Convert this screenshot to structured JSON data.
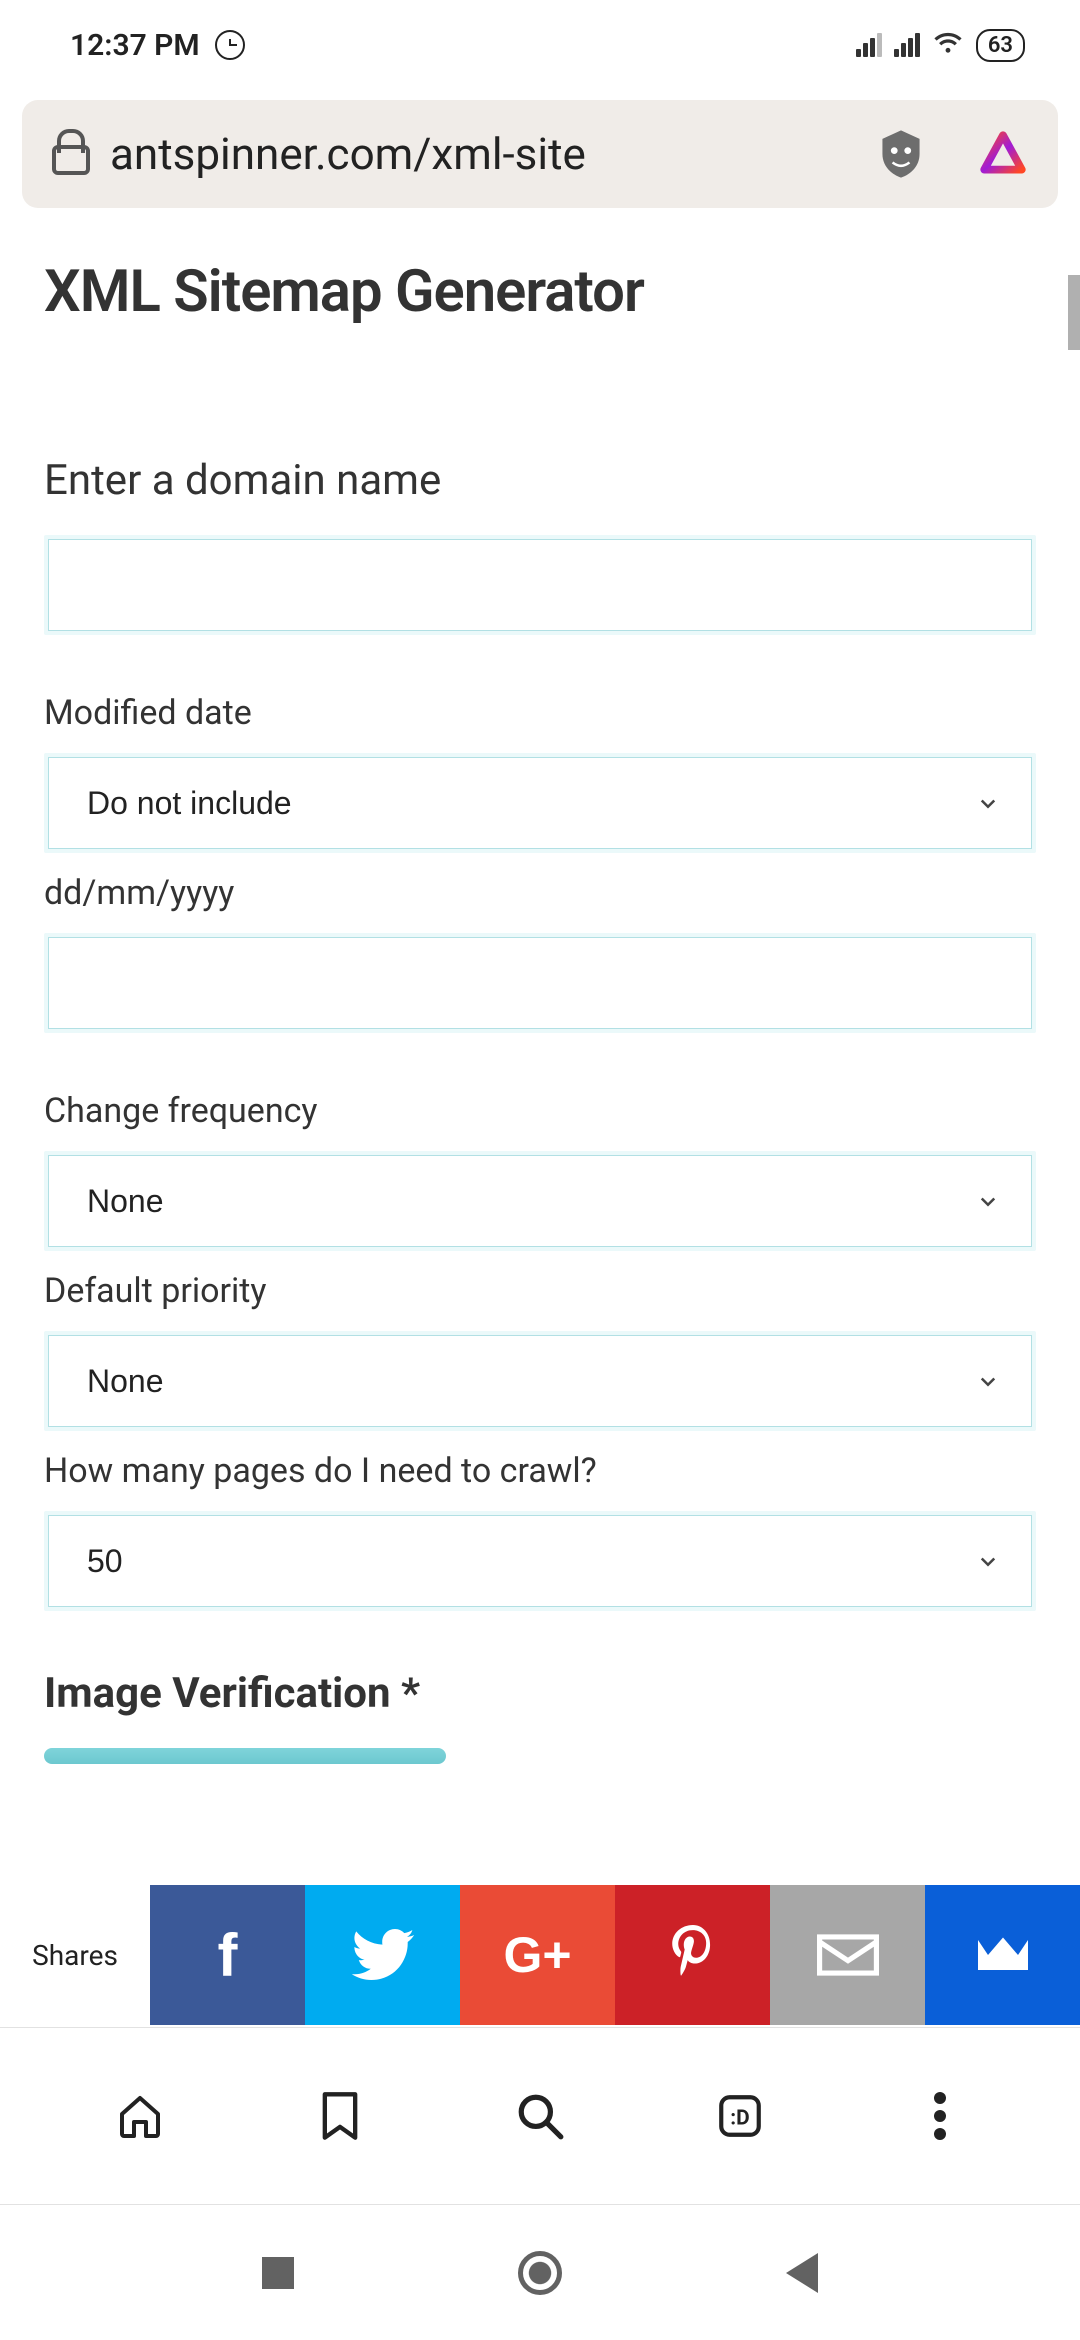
{
  "status": {
    "time": "12:37 PM",
    "battery": "63"
  },
  "url": "antspinner.com/xml-site",
  "page": {
    "title": "XML Sitemap Generator",
    "fields": {
      "domain": {
        "label": "Enter a domain name",
        "value": ""
      },
      "modified": {
        "label": "Modified date",
        "value": "Do not include"
      },
      "date": {
        "label": "dd/mm/yyyy",
        "value": ""
      },
      "freq": {
        "label": "Change frequency",
        "value": "None"
      },
      "priority": {
        "label": "Default priority",
        "value": "None"
      },
      "pages": {
        "label": "How many pages do I need to crawl?",
        "value": "50"
      },
      "captcha": {
        "label": "Image Verification *"
      }
    }
  },
  "shares": {
    "label": "Shares"
  },
  "tabs": ":D"
}
